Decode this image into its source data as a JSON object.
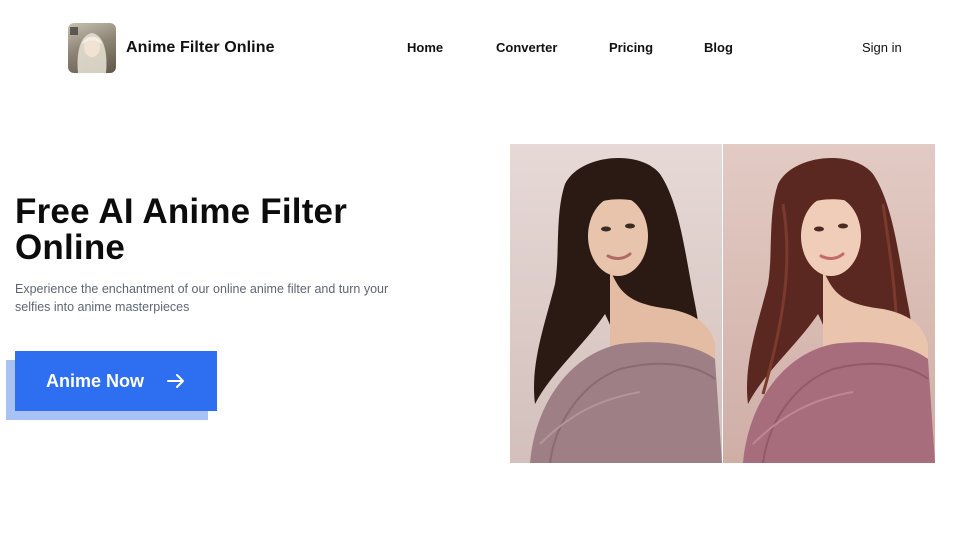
{
  "header": {
    "brand": "Anime Filter Online",
    "nav": {
      "home": "Home",
      "converter": "Converter",
      "pricing": "Pricing",
      "blog": "Blog"
    },
    "signin": "Sign in"
  },
  "hero": {
    "title": "Free AI Anime Filter Online",
    "subtitle": "Experience the enchantment of our online anime filter and turn your selfies into anime masterpieces",
    "cta_label": "Anime Now"
  },
  "colors": {
    "accent": "#2d6ff0",
    "accent_shadow": "#a8c2f4",
    "text_primary": "#0c0c0c",
    "text_secondary": "#5f6673"
  },
  "icons": {
    "cta": "arrow-right-icon"
  }
}
